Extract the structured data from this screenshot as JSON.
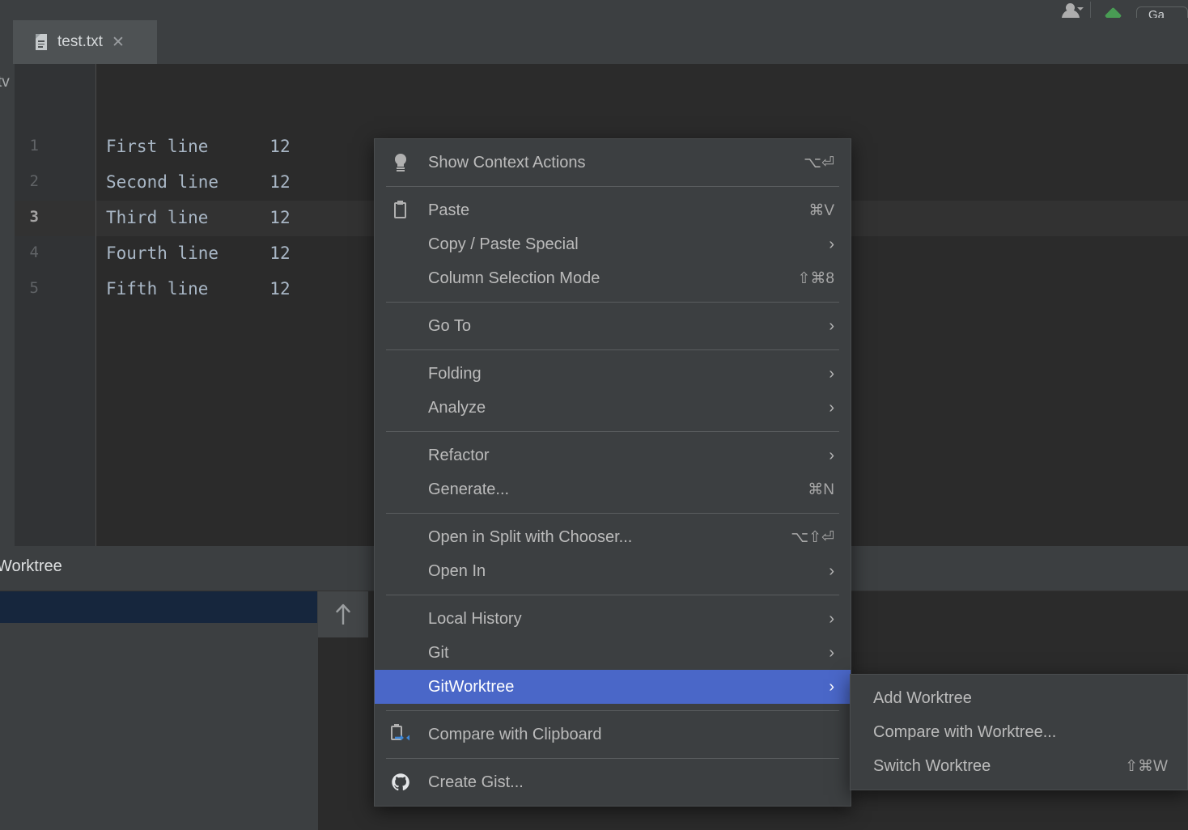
{
  "toolbar": {
    "avatar_icon": "user-avatar-icon",
    "dropdown_icon": "chevron-down-icon",
    "build_icon": "green-diamond-icon",
    "cut_button_label": "Ga"
  },
  "tab_bar": {
    "tabs": [
      {
        "label": "test.txt",
        "file_icon": "text-file-icon",
        "close_icon": "close-icon",
        "active": true
      }
    ]
  },
  "left_strip": {
    "label": "tv"
  },
  "editor": {
    "gutter": [
      "1",
      "2",
      "3",
      "4",
      "5"
    ],
    "current_line": 3,
    "lines": [
      "First line\t12",
      "Second line\t12",
      "Third line\t12",
      "Fourth line\t12",
      "Fifth line\t12"
    ]
  },
  "tool_window": {
    "title": "Worktree",
    "up_icon": "arrow-up-icon"
  },
  "context_menu": {
    "groups": [
      {
        "items": [
          {
            "label": "Show Context Actions",
            "icon": "lightbulb-icon",
            "shortcut": "⌥⏎",
            "arrow": ""
          }
        ]
      },
      {
        "items": [
          {
            "label": "Paste",
            "icon": "clipboard-icon",
            "shortcut": "⌘V",
            "arrow": ""
          },
          {
            "label": "Copy / Paste Special",
            "icon": "",
            "shortcut": "",
            "arrow": "›"
          },
          {
            "label": "Column Selection Mode",
            "icon": "",
            "shortcut": "⇧⌘8",
            "arrow": ""
          }
        ]
      },
      {
        "items": [
          {
            "label": "Go To",
            "icon": "",
            "shortcut": "",
            "arrow": "›"
          }
        ]
      },
      {
        "items": [
          {
            "label": "Folding",
            "icon": "",
            "shortcut": "",
            "arrow": "›"
          },
          {
            "label": "Analyze",
            "icon": "",
            "shortcut": "",
            "arrow": "›"
          }
        ]
      },
      {
        "items": [
          {
            "label": "Refactor",
            "icon": "",
            "shortcut": "",
            "arrow": "›"
          },
          {
            "label": "Generate...",
            "icon": "",
            "shortcut": "⌘N",
            "arrow": ""
          }
        ]
      },
      {
        "items": [
          {
            "label": "Open in Split with Chooser...",
            "icon": "",
            "shortcut": "⌥⇧⏎",
            "arrow": ""
          },
          {
            "label": "Open In",
            "icon": "",
            "shortcut": "",
            "arrow": "›"
          }
        ]
      },
      {
        "items": [
          {
            "label": "Local History",
            "icon": "",
            "shortcut": "",
            "arrow": "›"
          },
          {
            "label": "Git",
            "icon": "",
            "shortcut": "",
            "arrow": "›"
          },
          {
            "label": "GitWorktree",
            "icon": "",
            "shortcut": "",
            "arrow": "›",
            "selected": true
          }
        ]
      },
      {
        "items": [
          {
            "label": "Compare with Clipboard",
            "icon": "compare-clipboard-icon",
            "shortcut": "",
            "arrow": ""
          }
        ]
      },
      {
        "items": [
          {
            "label": "Create Gist...",
            "icon": "github-icon",
            "shortcut": "",
            "arrow": ""
          }
        ]
      }
    ]
  },
  "submenu": {
    "parent": "GitWorktree",
    "items": [
      {
        "label": "Add Worktree",
        "shortcut": ""
      },
      {
        "label": "Compare with Worktree...",
        "shortcut": ""
      },
      {
        "label": "Switch Worktree",
        "shortcut": "⇧⌘W"
      }
    ]
  },
  "colors": {
    "selection_blue": "#4a67c8",
    "panel_bg": "#3c3f41",
    "editor_bg": "#2b2b2b",
    "gutter_bg": "#313335",
    "tree_selected": "#16263d",
    "accent_green": "#499c54",
    "text": "#bbbbbb"
  }
}
